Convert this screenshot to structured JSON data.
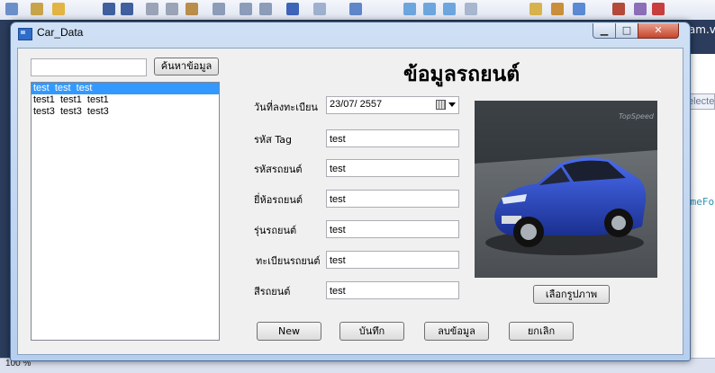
{
  "window": {
    "title": "Car_Data"
  },
  "ide": {
    "tab_text": "ram.v",
    "side_text": "electe",
    "code_text": "imeFo",
    "zoom_text": "100 %"
  },
  "search": {
    "value": "",
    "button_label": "ค้นหาข้อมูล"
  },
  "list": {
    "items": [
      "test  test  test",
      "test1  test1  test1",
      "test3  test3  test3"
    ],
    "selected_index": 0
  },
  "heading": "ข้อมูลรถยนต์",
  "form": {
    "date_label": "วันที่ลงทะเบียน",
    "date_value": "23/07/ 2557",
    "tag_label": "รหัส Tag",
    "tag_value": "test",
    "car_id_label": "รหัสรถยนต์",
    "car_id_value": "test",
    "brand_label": "ยี่ห้อรถยนต์",
    "brand_value": "test",
    "model_label": "รุ่นรถยนต์",
    "model_value": "test",
    "plate_label": "ทะเบียนรถยนต์",
    "plate_value": "test",
    "color_label": "สีรถยนต์",
    "color_value": "test"
  },
  "picture": {
    "watermark": "TopSpeed",
    "choose_label": "เลือกรูปภาพ"
  },
  "actions": {
    "new_label": "New",
    "save_label": "บันทึก",
    "delete_label": "ลบข้อมูล",
    "cancel_label": "ยกเลิก"
  },
  "colors": {
    "selection": "#3399ff",
    "car_body": "#1f3fb8"
  }
}
